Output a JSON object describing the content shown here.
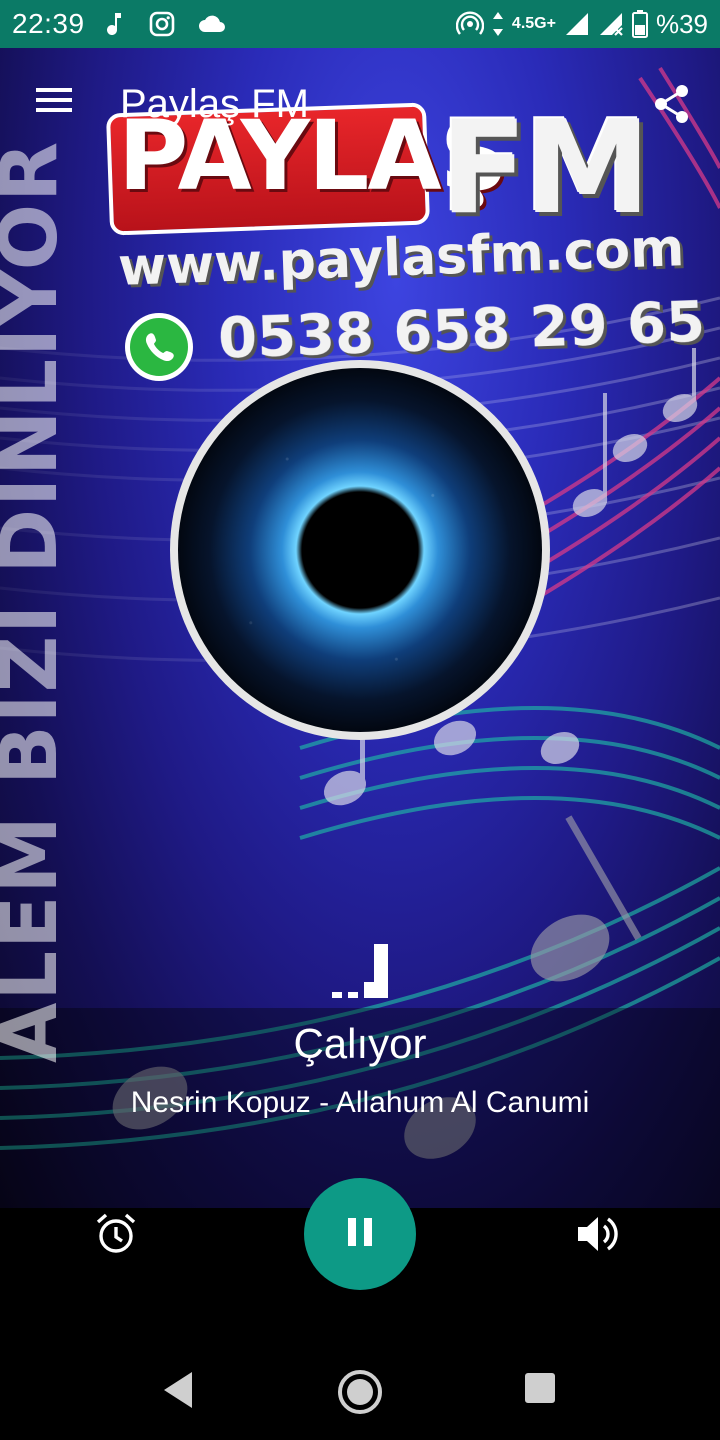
{
  "status_bar": {
    "time": "22:39",
    "network": "4.5G+",
    "battery": "%39",
    "icons_left": [
      "music-note-icon",
      "instagram-icon",
      "cloud-icon"
    ],
    "icons_right": [
      "hotspot-icon",
      "data-arrows-icon",
      "signal-icon",
      "signal-no-data-icon",
      "battery-icon"
    ]
  },
  "app_bar": {
    "title": "Paylaş FM",
    "menu_icon": "hamburger-menu-icon",
    "share_icon": "share-icon"
  },
  "artwork": {
    "logo_word": "PAYLAŞ",
    "logo_fm": "FM",
    "url": "www.paylasfm.com",
    "phone": "0538 658 29 65",
    "side_text": "ALEM BIZI DINLIYOR",
    "colors": {
      "background": "#2a2bb8",
      "logo_red": "#e8262a"
    }
  },
  "player": {
    "status": "Çalıyor",
    "track": "Nesrin Kopuz - Allahum Al Canumi",
    "state": "playing"
  },
  "controls": {
    "alarm_icon": "alarm-clock-icon",
    "pause_icon": "pause-icon",
    "volume_icon": "volume-icon",
    "accent": "#0d9a86"
  },
  "nav_bar": {
    "back_icon": "back-icon",
    "home_icon": "home-icon",
    "recent_icon": "recent-apps-icon"
  }
}
